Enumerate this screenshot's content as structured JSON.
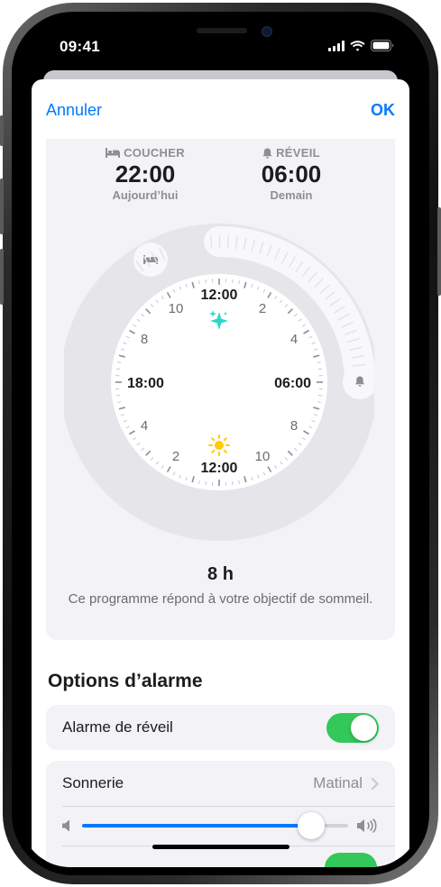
{
  "status": {
    "time": "09:41"
  },
  "nav": {
    "cancel_label": "Annuler",
    "ok_label": "OK"
  },
  "schedule": {
    "bedtime": {
      "label": "COUCHER",
      "time": "22:00",
      "day": "Aujourd’hui",
      "icon": "bed-icon"
    },
    "wake": {
      "label": "RÉVEIL",
      "time": "06:00",
      "day": "Demain",
      "icon": "bell-icon"
    },
    "clock_labels": {
      "top": "12:00",
      "bottom": "12:00",
      "left": "18:00",
      "right": "06:00",
      "n10_top": "10",
      "n2_top": "2",
      "n8_left": "8",
      "n4_right": "4",
      "n4_left": "4",
      "n8_right": "8",
      "n2_bottom": "2",
      "n10_bottom": "10"
    },
    "duration": "8 h",
    "goal_message": "Ce programme répond à votre objectif de sommeil.",
    "colors": {
      "ring": "#e5e5ea",
      "arc": "#f7f7f9",
      "sparkle": "#2ed6c8",
      "sun": "#ffcc00"
    }
  },
  "alarm_options": {
    "title": "Options d’alarme",
    "wake_alarm": {
      "label": "Alarme de réveil",
      "enabled": true
    },
    "sound": {
      "label": "Sonnerie",
      "value": "Matinal"
    },
    "volume": {
      "level": 0.86
    }
  },
  "colors": {
    "accent": "#007aff",
    "toggle_on": "#34c759",
    "card_bg": "#f2f2f7"
  }
}
